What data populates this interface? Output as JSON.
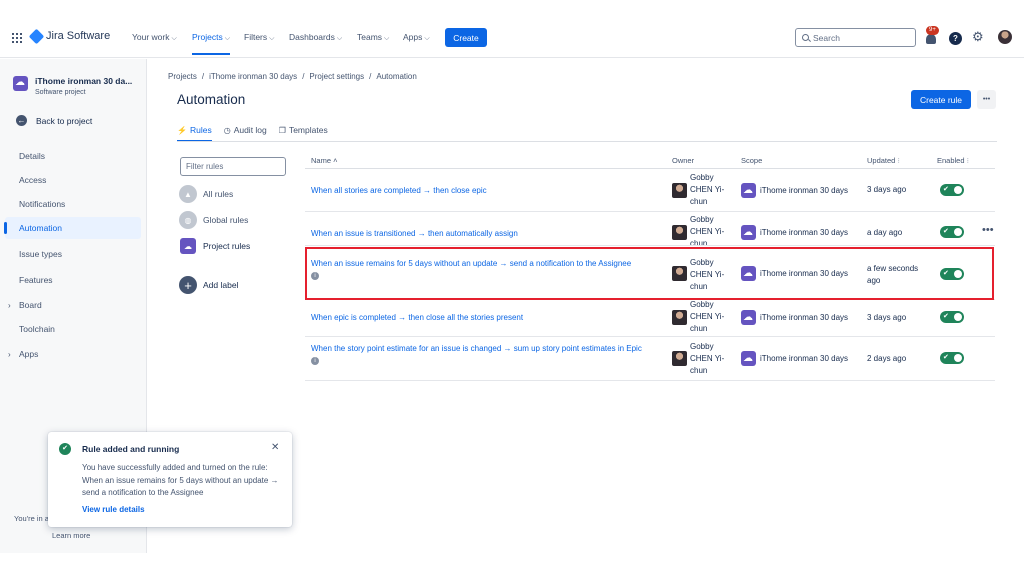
{
  "app": {
    "name": "Jira Software"
  },
  "topnav": {
    "items": [
      {
        "label": "Your work",
        "active": false
      },
      {
        "label": "Projects",
        "active": true
      },
      {
        "label": "Filters",
        "active": false
      },
      {
        "label": "Dashboards",
        "active": false
      },
      {
        "label": "Teams",
        "active": false
      },
      {
        "label": "Apps",
        "active": false
      }
    ],
    "create_label": "Create",
    "search_placeholder": "Search",
    "notification_badge": "9+",
    "help_glyph": "?"
  },
  "sidebar": {
    "project_name": "iThome ironman 30 da...",
    "project_type": "Software project",
    "back_label": "Back to project",
    "items": [
      {
        "label": "Details"
      },
      {
        "label": "Access"
      },
      {
        "label": "Notifications"
      },
      {
        "label": "Automation",
        "active": true
      },
      {
        "label": "Issue types"
      },
      {
        "label": "Features"
      },
      {
        "label": "Board",
        "expandable": true
      },
      {
        "label": "Toolchain"
      },
      {
        "label": "Apps",
        "expandable": true
      }
    ],
    "footer_text": "You're in a",
    "learn_more": "Learn more"
  },
  "breadcrumb": [
    "Projects",
    "iThome ironman 30 days",
    "Project settings",
    "Automation"
  ],
  "page": {
    "title": "Automation",
    "create_rule_label": "Create rule",
    "more_glyph": "•••"
  },
  "tabs": [
    {
      "label": "Rules",
      "icon": "lightning-icon",
      "active": true
    },
    {
      "label": "Audit log",
      "icon": "clock-icon",
      "active": false
    },
    {
      "label": "Templates",
      "icon": "copy-icon",
      "active": false
    }
  ],
  "filters": {
    "placeholder": "Filter rules",
    "categories": [
      {
        "label": "All rules"
      },
      {
        "label": "Global rules"
      },
      {
        "label": "Project rules"
      }
    ],
    "add_label": "Add label"
  },
  "table": {
    "columns": {
      "name": "Name",
      "owner": "Owner",
      "scope": "Scope",
      "updated": "Updated",
      "enabled": "Enabled"
    },
    "rows": [
      {
        "name": "When all stories are completed → then close epic",
        "owner": "Gobby CHEN Yi-chun",
        "scope": "iThome ironman 30 days",
        "updated": "3 days ago",
        "enabled": true
      },
      {
        "name": "When an issue is transitioned → then automatically assign",
        "owner": "Gobby CHEN Yi-chun",
        "scope": "iThome ironman 30 days",
        "updated": "a day ago",
        "enabled": true
      },
      {
        "name": "When an issue remains for 5 days without an update → send a notification to the Assignee",
        "owner": "Gobby CHEN Yi-chun",
        "scope": "iThome ironman 30 days",
        "updated": "a few seconds ago",
        "enabled": true
      },
      {
        "name": "When epic is completed → then close all the stories present",
        "owner": "Gobby CHEN Yi-chun",
        "scope": "iThome ironman 30 days",
        "updated": "3 days ago",
        "enabled": true
      },
      {
        "name": "When the story point estimate for an issue is changed → sum up story point estimates in Epic",
        "owner": "Gobby CHEN Yi-chun",
        "scope": "iThome ironman 30 days",
        "updated": "2 days ago",
        "enabled": true
      }
    ]
  },
  "toast": {
    "title": "Rule added and running",
    "body": "You have successfully added and turned on the rule: When an issue remains for 5 days without an update → send a notification to the Assignee",
    "link": "View rule details",
    "close_glyph": "✕"
  },
  "colors": {
    "accent": "#0c66e4",
    "toggle_on": "#1f845a",
    "highlight": "#e5202e",
    "project_avatar": "#6554c0"
  }
}
